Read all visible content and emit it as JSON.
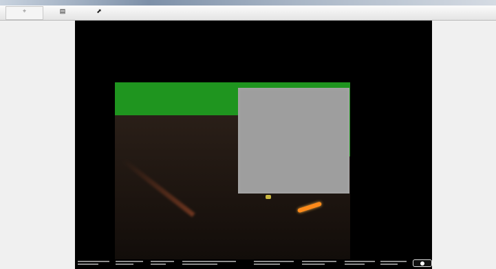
{
  "window": {
    "title": ""
  },
  "toolbar": {
    "buttons": [
      {
        "icon": "zoom-icon",
        "label": ""
      },
      {
        "icon": "camera-icon",
        "label": ""
      },
      {
        "icon": "export-icon",
        "label": ""
      }
    ]
  },
  "viewer": {
    "info_fields": [
      "",
      "",
      "",
      "",
      "",
      "",
      "",
      "",
      ""
    ]
  },
  "logo": {
    "text": ""
  }
}
